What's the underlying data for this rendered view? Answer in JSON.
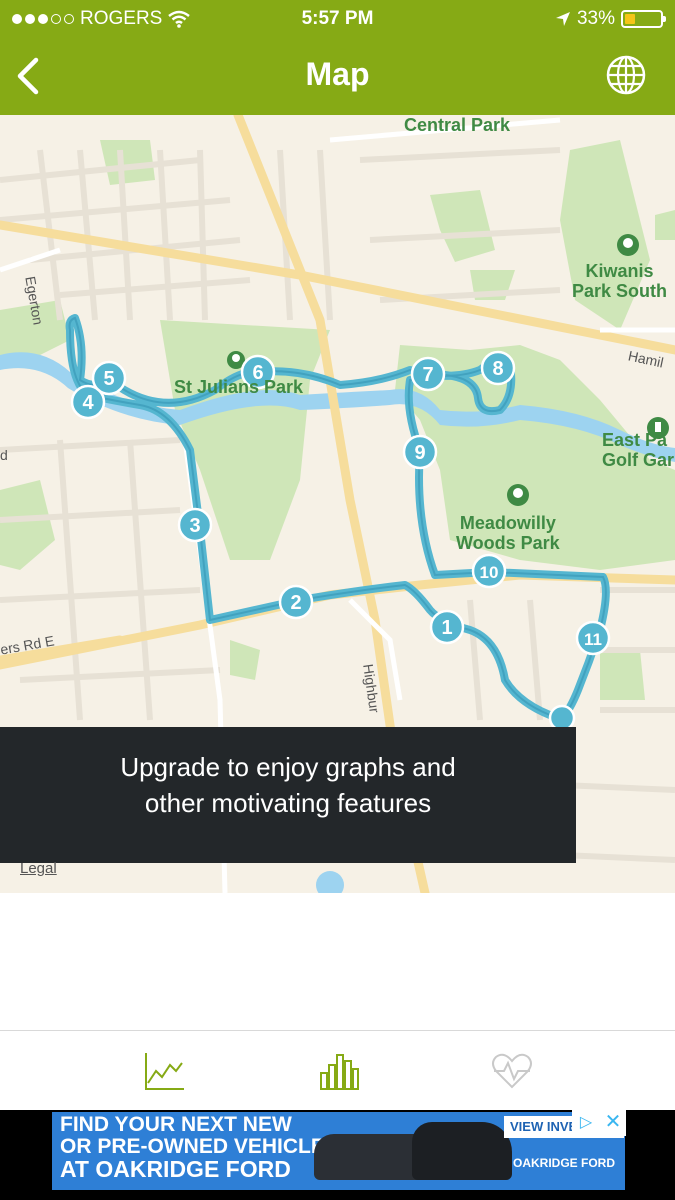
{
  "status_bar": {
    "carrier": "ROGERS",
    "time": "5:57 PM",
    "battery": "33%"
  },
  "nav": {
    "title": "Map",
    "back_icon": "chevron-left-icon",
    "globe_icon": "globe-icon"
  },
  "map": {
    "places": {
      "central_park": "Central Park",
      "kiwanis": "Kiwanis\nPark South",
      "st_julians": "St Julians Park",
      "meadowilly": "Meadowilly\nWoods Park",
      "east_park": "East Pa\nGolf Gar"
    },
    "roads": {
      "egerton": "Egerton",
      "hamilton": "Hamil",
      "rd_e": "ers Rd E",
      "highbury": "Highbur",
      "d": "d"
    },
    "markers": [
      "1",
      "2",
      "3",
      "4",
      "5",
      "6",
      "7",
      "8",
      "9",
      "10",
      "11"
    ],
    "legal": "Legal",
    "route_color": "#55b6d0"
  },
  "banner": {
    "line1": "Upgrade to enjoy graphs and",
    "line2": "other motivating features"
  },
  "tabs": [
    {
      "icon": "line-graph-icon"
    },
    {
      "icon": "bar-chart-icon"
    },
    {
      "icon": "heart-rate-icon"
    }
  ],
  "ad": {
    "line1": "FIND YOUR NEXT NEW",
    "line2": "OR PRE-OWNED VEHICLE",
    "line3": "AT OAKRIDGE FORD",
    "cta": "VIEW INVE",
    "brand": "OAKRIDGE FORD",
    "close": "✕",
    "choice": "▷"
  }
}
